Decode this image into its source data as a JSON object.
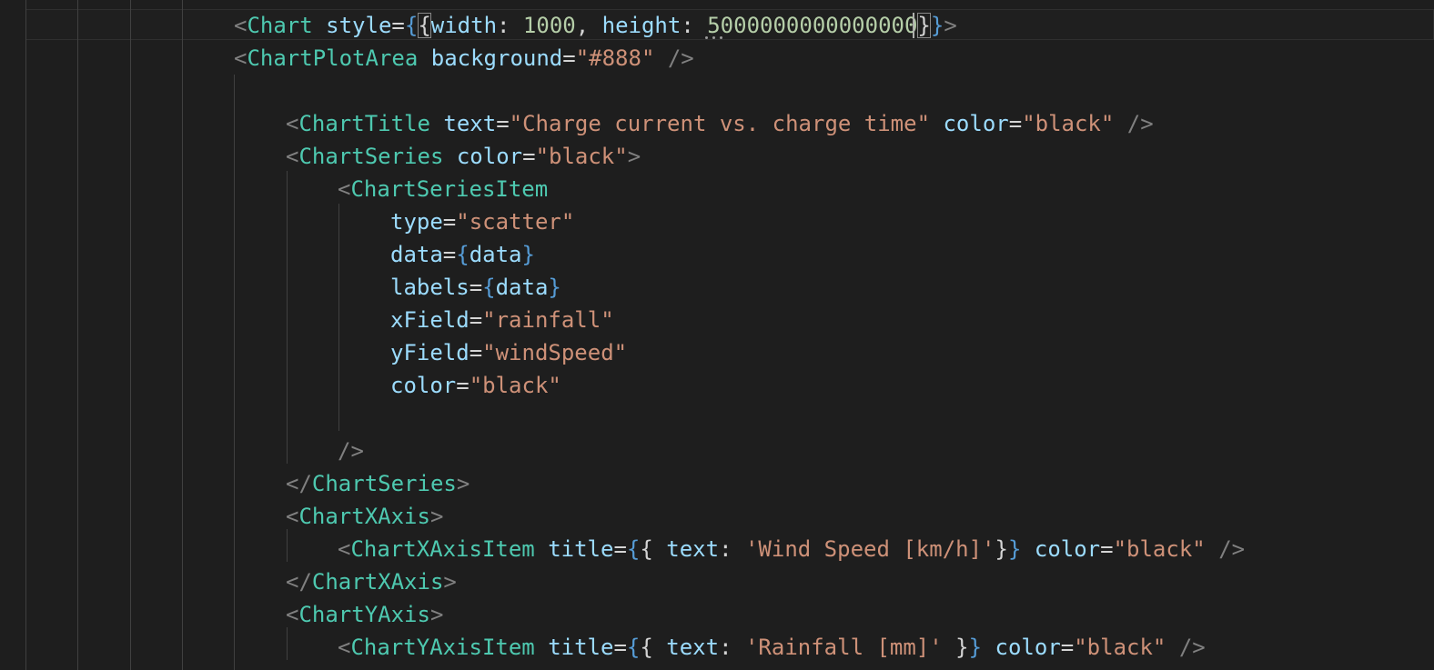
{
  "editor": {
    "lines": [
      {
        "t": [
          [
            "<",
            "tag-bracket"
          ],
          [
            "Chart",
            "tag-name"
          ],
          [
            " ",
            "punct"
          ],
          [
            "style",
            "attr"
          ],
          [
            "=",
            "punct"
          ],
          [
            "{",
            "brace"
          ],
          [
            "{",
            "punct"
          ],
          [
            "width",
            "attr"
          ],
          [
            ": ",
            "punct"
          ],
          [
            "1000",
            "num"
          ],
          [
            ", ",
            "punct"
          ],
          [
            "height",
            "attr"
          ],
          [
            ": ",
            "punct"
          ],
          [
            "5000000000000000",
            "num"
          ],
          [
            "}",
            "punct"
          ],
          [
            "}",
            "brace"
          ],
          [
            ">",
            "tag-bracket"
          ]
        ]
      },
      {
        "t": [
          [
            "<",
            "tag-bracket"
          ],
          [
            "ChartPlotArea",
            "tag-name"
          ],
          [
            " ",
            "punct"
          ],
          [
            "background",
            "attr"
          ],
          [
            "=",
            "punct"
          ],
          [
            "\"#888\"",
            "str"
          ],
          [
            " ",
            "punct"
          ],
          [
            "/>",
            "tag-bracket"
          ]
        ]
      },
      {
        "t": []
      },
      {
        "t": [
          [
            "<",
            "tag-bracket"
          ],
          [
            "ChartTitle",
            "tag-name"
          ],
          [
            " ",
            "punct"
          ],
          [
            "text",
            "attr"
          ],
          [
            "=",
            "punct"
          ],
          [
            "\"Charge current vs. charge time\"",
            "str"
          ],
          [
            " ",
            "punct"
          ],
          [
            "color",
            "attr"
          ],
          [
            "=",
            "punct"
          ],
          [
            "\"black\"",
            "str"
          ],
          [
            " ",
            "punct"
          ],
          [
            "/>",
            "tag-bracket"
          ]
        ]
      },
      {
        "t": [
          [
            "<",
            "tag-bracket"
          ],
          [
            "ChartSeries",
            "tag-name"
          ],
          [
            " ",
            "punct"
          ],
          [
            "color",
            "attr"
          ],
          [
            "=",
            "punct"
          ],
          [
            "\"black\"",
            "str"
          ],
          [
            ">",
            "tag-bracket"
          ]
        ]
      },
      {
        "t": [
          [
            "<",
            "tag-bracket"
          ],
          [
            "ChartSeriesItem",
            "tag-name"
          ]
        ]
      },
      {
        "t": [
          [
            "type",
            "attr"
          ],
          [
            "=",
            "punct"
          ],
          [
            "\"scatter\"",
            "str"
          ]
        ]
      },
      {
        "t": [
          [
            "data",
            "attr"
          ],
          [
            "=",
            "punct"
          ],
          [
            "{",
            "brace"
          ],
          [
            "data",
            "attr"
          ],
          [
            "}",
            "brace"
          ]
        ]
      },
      {
        "t": [
          [
            "labels",
            "attr"
          ],
          [
            "=",
            "punct"
          ],
          [
            "{",
            "brace"
          ],
          [
            "data",
            "attr"
          ],
          [
            "}",
            "brace"
          ]
        ]
      },
      {
        "t": [
          [
            "xField",
            "attr"
          ],
          [
            "=",
            "punct"
          ],
          [
            "\"rainfall\"",
            "str"
          ]
        ]
      },
      {
        "t": [
          [
            "yField",
            "attr"
          ],
          [
            "=",
            "punct"
          ],
          [
            "\"windSpeed\"",
            "str"
          ]
        ]
      },
      {
        "t": [
          [
            "color",
            "attr"
          ],
          [
            "=",
            "punct"
          ],
          [
            "\"black\"",
            "str"
          ]
        ]
      },
      {
        "t": []
      },
      {
        "t": [
          [
            "/>",
            "tag-bracket"
          ]
        ]
      },
      {
        "t": [
          [
            "</",
            "tag-bracket"
          ],
          [
            "ChartSeries",
            "tag-name"
          ],
          [
            ">",
            "tag-bracket"
          ]
        ]
      },
      {
        "t": [
          [
            "<",
            "tag-bracket"
          ],
          [
            "ChartXAxis",
            "tag-name"
          ],
          [
            ">",
            "tag-bracket"
          ]
        ]
      },
      {
        "t": [
          [
            "<",
            "tag-bracket"
          ],
          [
            "ChartXAxisItem",
            "tag-name"
          ],
          [
            " ",
            "punct"
          ],
          [
            "title",
            "attr"
          ],
          [
            "=",
            "punct"
          ],
          [
            "{",
            "brace"
          ],
          [
            "{ ",
            "punct"
          ],
          [
            "text",
            "attr"
          ],
          [
            ": ",
            "punct"
          ],
          [
            "'Wind Speed [km/h]'",
            "str"
          ],
          [
            "}",
            "punct"
          ],
          [
            "}",
            "brace"
          ],
          [
            " ",
            "punct"
          ],
          [
            "color",
            "attr"
          ],
          [
            "=",
            "punct"
          ],
          [
            "\"black\"",
            "str"
          ],
          [
            " ",
            "punct"
          ],
          [
            "/>",
            "tag-bracket"
          ]
        ]
      },
      {
        "t": [
          [
            "</",
            "tag-bracket"
          ],
          [
            "ChartXAxis",
            "tag-name"
          ],
          [
            ">",
            "tag-bracket"
          ]
        ]
      },
      {
        "t": [
          [
            "<",
            "tag-bracket"
          ],
          [
            "ChartYAxis",
            "tag-name"
          ],
          [
            ">",
            "tag-bracket"
          ]
        ]
      },
      {
        "t": [
          [
            "<",
            "tag-bracket"
          ],
          [
            "ChartYAxisItem",
            "tag-name"
          ],
          [
            " ",
            "punct"
          ],
          [
            "title",
            "attr"
          ],
          [
            "=",
            "punct"
          ],
          [
            "{",
            "brace"
          ],
          [
            "{ ",
            "punct"
          ],
          [
            "text",
            "attr"
          ],
          [
            ": ",
            "punct"
          ],
          [
            "'Rainfall [mm]'",
            "str"
          ],
          [
            " ",
            "punct"
          ],
          [
            "}",
            "punct"
          ],
          [
            "}",
            "brace"
          ],
          [
            " ",
            "punct"
          ],
          [
            "color",
            "attr"
          ],
          [
            "=",
            "punct"
          ],
          [
            "\"black\"",
            "str"
          ],
          [
            " ",
            "punct"
          ],
          [
            "/>",
            "tag-bracket"
          ]
        ]
      }
    ],
    "theme": {
      "background": "#1e1e1e",
      "tag_name": "#4ec9b0",
      "attribute": "#9cdcfe",
      "string": "#ce9178",
      "number": "#b5cea8",
      "brace": "#569cd6",
      "bracket": "#808080"
    }
  }
}
